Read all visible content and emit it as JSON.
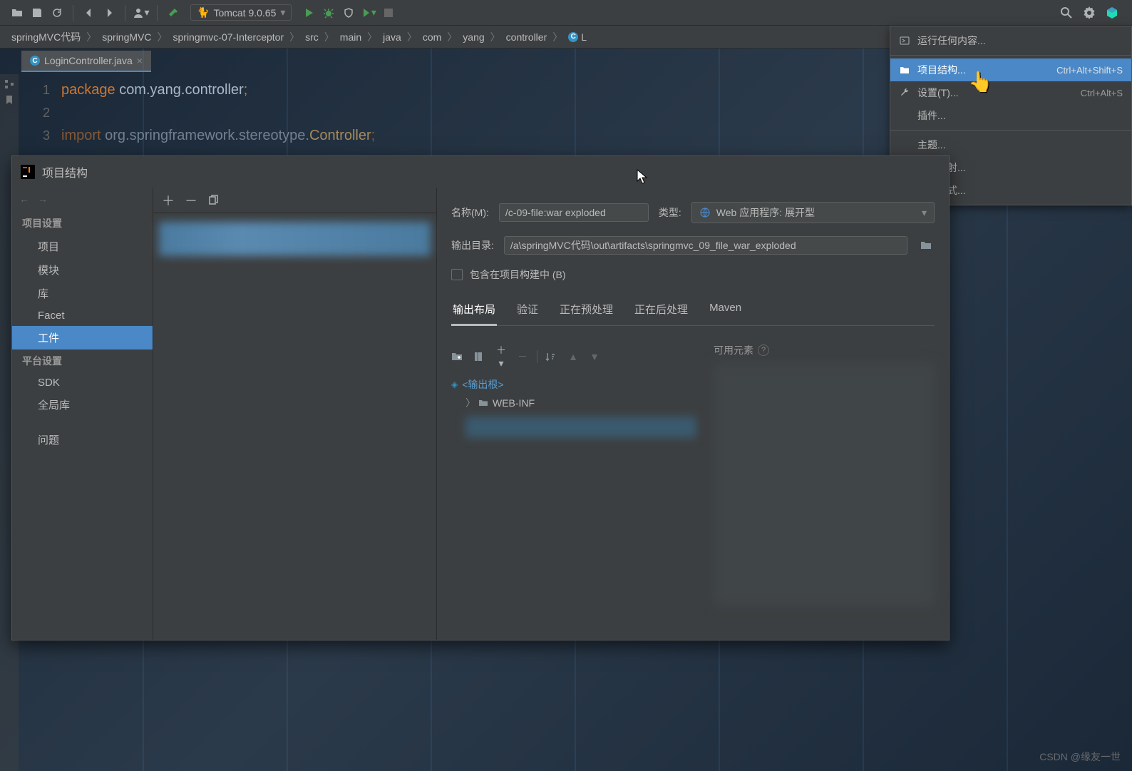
{
  "toolbar": {
    "run_config": "Tomcat 9.0.65"
  },
  "breadcrumb": {
    "items": [
      "springMVC代码",
      "springMVC",
      "springmvc-07-Interceptor",
      "src",
      "main",
      "java",
      "com",
      "yang",
      "controller",
      "L"
    ]
  },
  "editor": {
    "tab_name": "LoginController.java",
    "line_numbers": [
      "1",
      "2",
      "3"
    ],
    "code_line1_kw": "package",
    "code_line1_pkg": "com.yang.controller",
    "code_line3_partial_kw": "import",
    "code_line3_partial_pkg": "org.springframework.stereotype.",
    "code_line3_partial_cls": "Controller"
  },
  "settings_menu": {
    "items": [
      {
        "icon": "run",
        "label": "运行任何内容...",
        "shortcut": ""
      },
      {
        "icon": "folder",
        "label": "项目结构...",
        "shortcut": "Ctrl+Alt+Shift+S",
        "highlighted": true
      },
      {
        "icon": "wrench",
        "label": "设置(T)...",
        "shortcut": "Ctrl+Alt+S"
      },
      {
        "icon": "",
        "label": "插件...",
        "shortcut": ""
      },
      {
        "sep": true
      },
      {
        "icon": "",
        "label": "主题...",
        "shortcut": ""
      },
      {
        "icon": "",
        "label": "按键映射...",
        "shortcut": ""
      },
      {
        "icon": "",
        "label": "视图模式...",
        "shortcut": ""
      }
    ]
  },
  "dialog": {
    "title": "项目结构",
    "sidebar": {
      "section1": "项目设置",
      "items1": [
        "项目",
        "模块",
        "库",
        "Facet",
        "工件"
      ],
      "section2": "平台设置",
      "items2": [
        "SDK",
        "全局库"
      ],
      "section3_item": "问题",
      "selected": "工件"
    },
    "form": {
      "name_label": "名称(M):",
      "name_value": "/c-09-file:war exploded",
      "type_label": "类型:",
      "type_value": "Web 应用程序: 展开型",
      "output_label": "输出目录:",
      "output_value": "/a\\springMVC代码\\out\\artifacts\\springmvc_09_file_war_exploded",
      "checkbox_label": "包含在项目构建中 (B)"
    },
    "tabs": [
      "输出布局",
      "验证",
      "正在预处理",
      "正在后处理",
      "Maven"
    ],
    "active_tab": "输出布局",
    "output_tree": {
      "root": "<输出根>",
      "child": "WEB-INF"
    },
    "available_label": "可用元素"
  },
  "watermark": "CSDN @缘友一世"
}
